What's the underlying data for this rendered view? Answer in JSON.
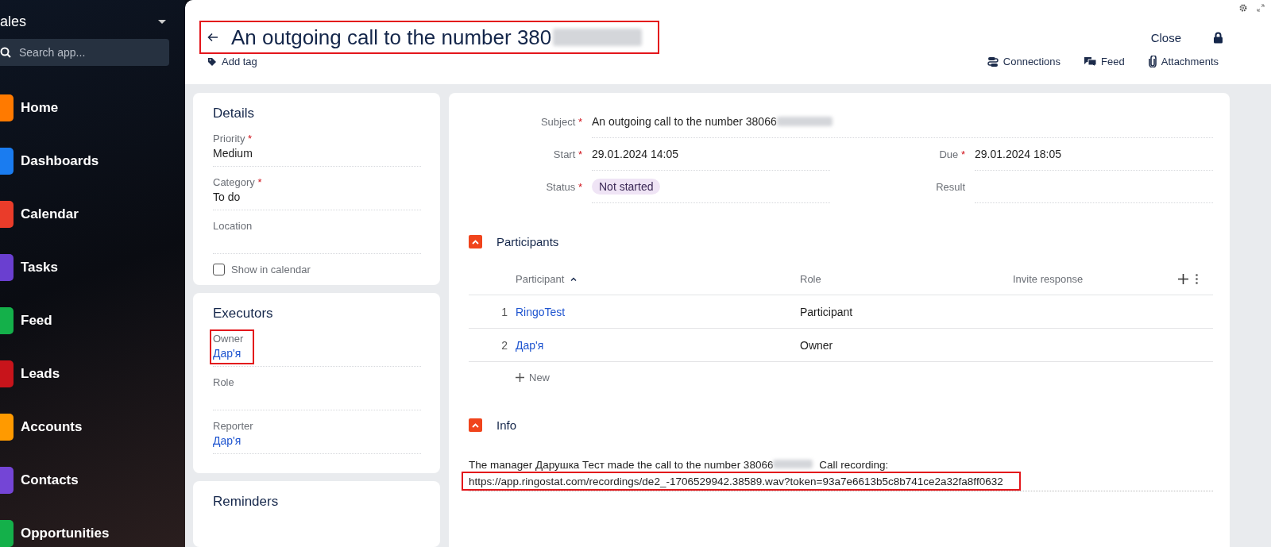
{
  "sidebar": {
    "app_title": "ales",
    "search": {
      "placeholder": "Search app..."
    },
    "items": [
      {
        "label": "Home",
        "color": "#ff7a00"
      },
      {
        "label": "Dashboards",
        "color": "#1a7cf0"
      },
      {
        "label": "Calendar",
        "color": "#ea3c2a"
      },
      {
        "label": "Tasks",
        "color": "#6a3fd0"
      },
      {
        "label": "Feed",
        "color": "#14b04a"
      },
      {
        "label": "Leads",
        "color": "#c8141b"
      },
      {
        "label": "Accounts",
        "color": "#ff9a00"
      },
      {
        "label": "Contacts",
        "color": "#7445d6"
      },
      {
        "label": "Opportunities",
        "color": "#14b04a"
      }
    ]
  },
  "header": {
    "title": "An outgoing call to the number 380",
    "title_redacted": true,
    "highlighted": true,
    "add_tag": "Add tag",
    "close": "Close",
    "actions": [
      {
        "label": "Connections",
        "kind": "connections"
      },
      {
        "label": "Feed",
        "kind": "feed"
      },
      {
        "label": "Attachments",
        "kind": "attachments"
      }
    ]
  },
  "details": {
    "title": "Details",
    "fields": [
      {
        "label": "Priority",
        "required_mark": "*",
        "value": "Medium"
      },
      {
        "label": "Category",
        "required_mark": "*",
        "value": "To do"
      },
      {
        "label": "Location"
      }
    ],
    "show_in_calendar": {
      "label": "Show in calendar",
      "checked": false
    }
  },
  "executors": {
    "title": "Executors",
    "fields": [
      {
        "label": "Owner",
        "value": "Дар'я",
        "highlighted": true
      },
      {
        "label": "Role",
        "highlighted": false
      },
      {
        "label": "Reporter",
        "value": "Дар'я",
        "highlighted": false
      }
    ]
  },
  "reminders": {
    "title": "Reminders"
  },
  "task": {
    "subject": {
      "label": "Subject",
      "required_mark": "*",
      "value": "An outgoing call to the number 38066",
      "redacted": true
    },
    "start": {
      "label": "Start",
      "required_mark": "*",
      "value": "29.01.2024 14:05"
    },
    "due": {
      "label": "Due",
      "required_mark": "*",
      "value": "29.01.2024 18:05"
    },
    "status": {
      "label": "Status",
      "required_mark": "*",
      "value": "Not started"
    },
    "result": {
      "label": "Result"
    }
  },
  "participants": {
    "title": "Participants",
    "expanded": true,
    "columns": [
      {
        "label": "Participant",
        "sorted_ascending": true
      },
      {
        "label": "Role"
      },
      {
        "label": "Invite response"
      }
    ],
    "rows": [
      {
        "index": "1",
        "name": "RingoTest",
        "role": "Participant"
      },
      {
        "index": "2",
        "name": "Дар'я",
        "role": "Owner"
      }
    ],
    "add_label": "New"
  },
  "info": {
    "title": "Info",
    "expanded": true,
    "text": "The manager Дарушка Тест made the call to the number 38066",
    "redacted": true,
    "text_after": "Call recording:",
    "link": "https://app.ringostat.com/recordings/de2_-1706529942.38589.wav?token=93a7e6613b5c8b741ce2a32fa8ff0632",
    "link_highlighted": true
  }
}
